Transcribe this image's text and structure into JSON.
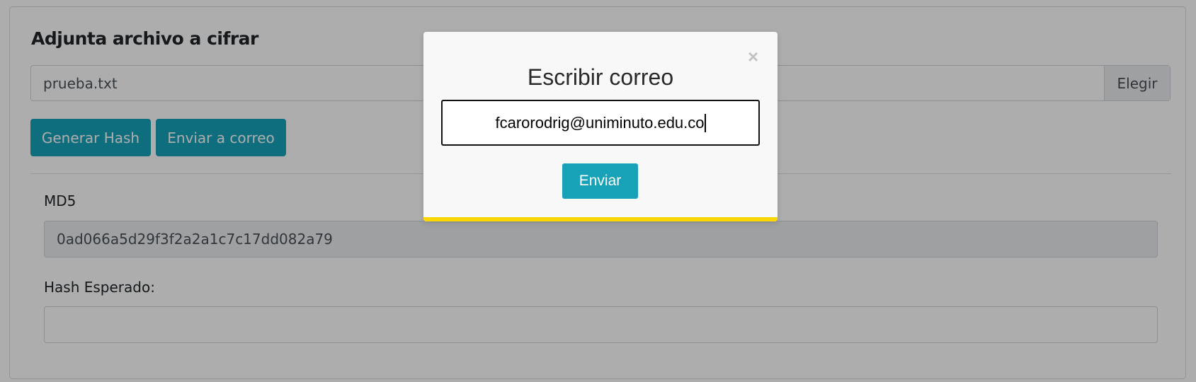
{
  "form": {
    "heading": "Adjunta archivo a cifrar",
    "file_value": "prueba.txt",
    "file_button": "Elegir",
    "generate_hash_button": "Generar Hash",
    "send_email_button": "Enviar a correo",
    "md5_label": "MD5",
    "md5_value": "0ad066a5d29f3f2a2a1c7c17dd082a79",
    "expected_hash_label": "Hash Esperado:",
    "expected_hash_value": ""
  },
  "modal": {
    "title": "Escribir correo",
    "close_icon": "×",
    "email_value": "fcarorodrig@uniminuto.edu.co",
    "send_button": "Enviar",
    "accent_color": "#fcd700"
  }
}
